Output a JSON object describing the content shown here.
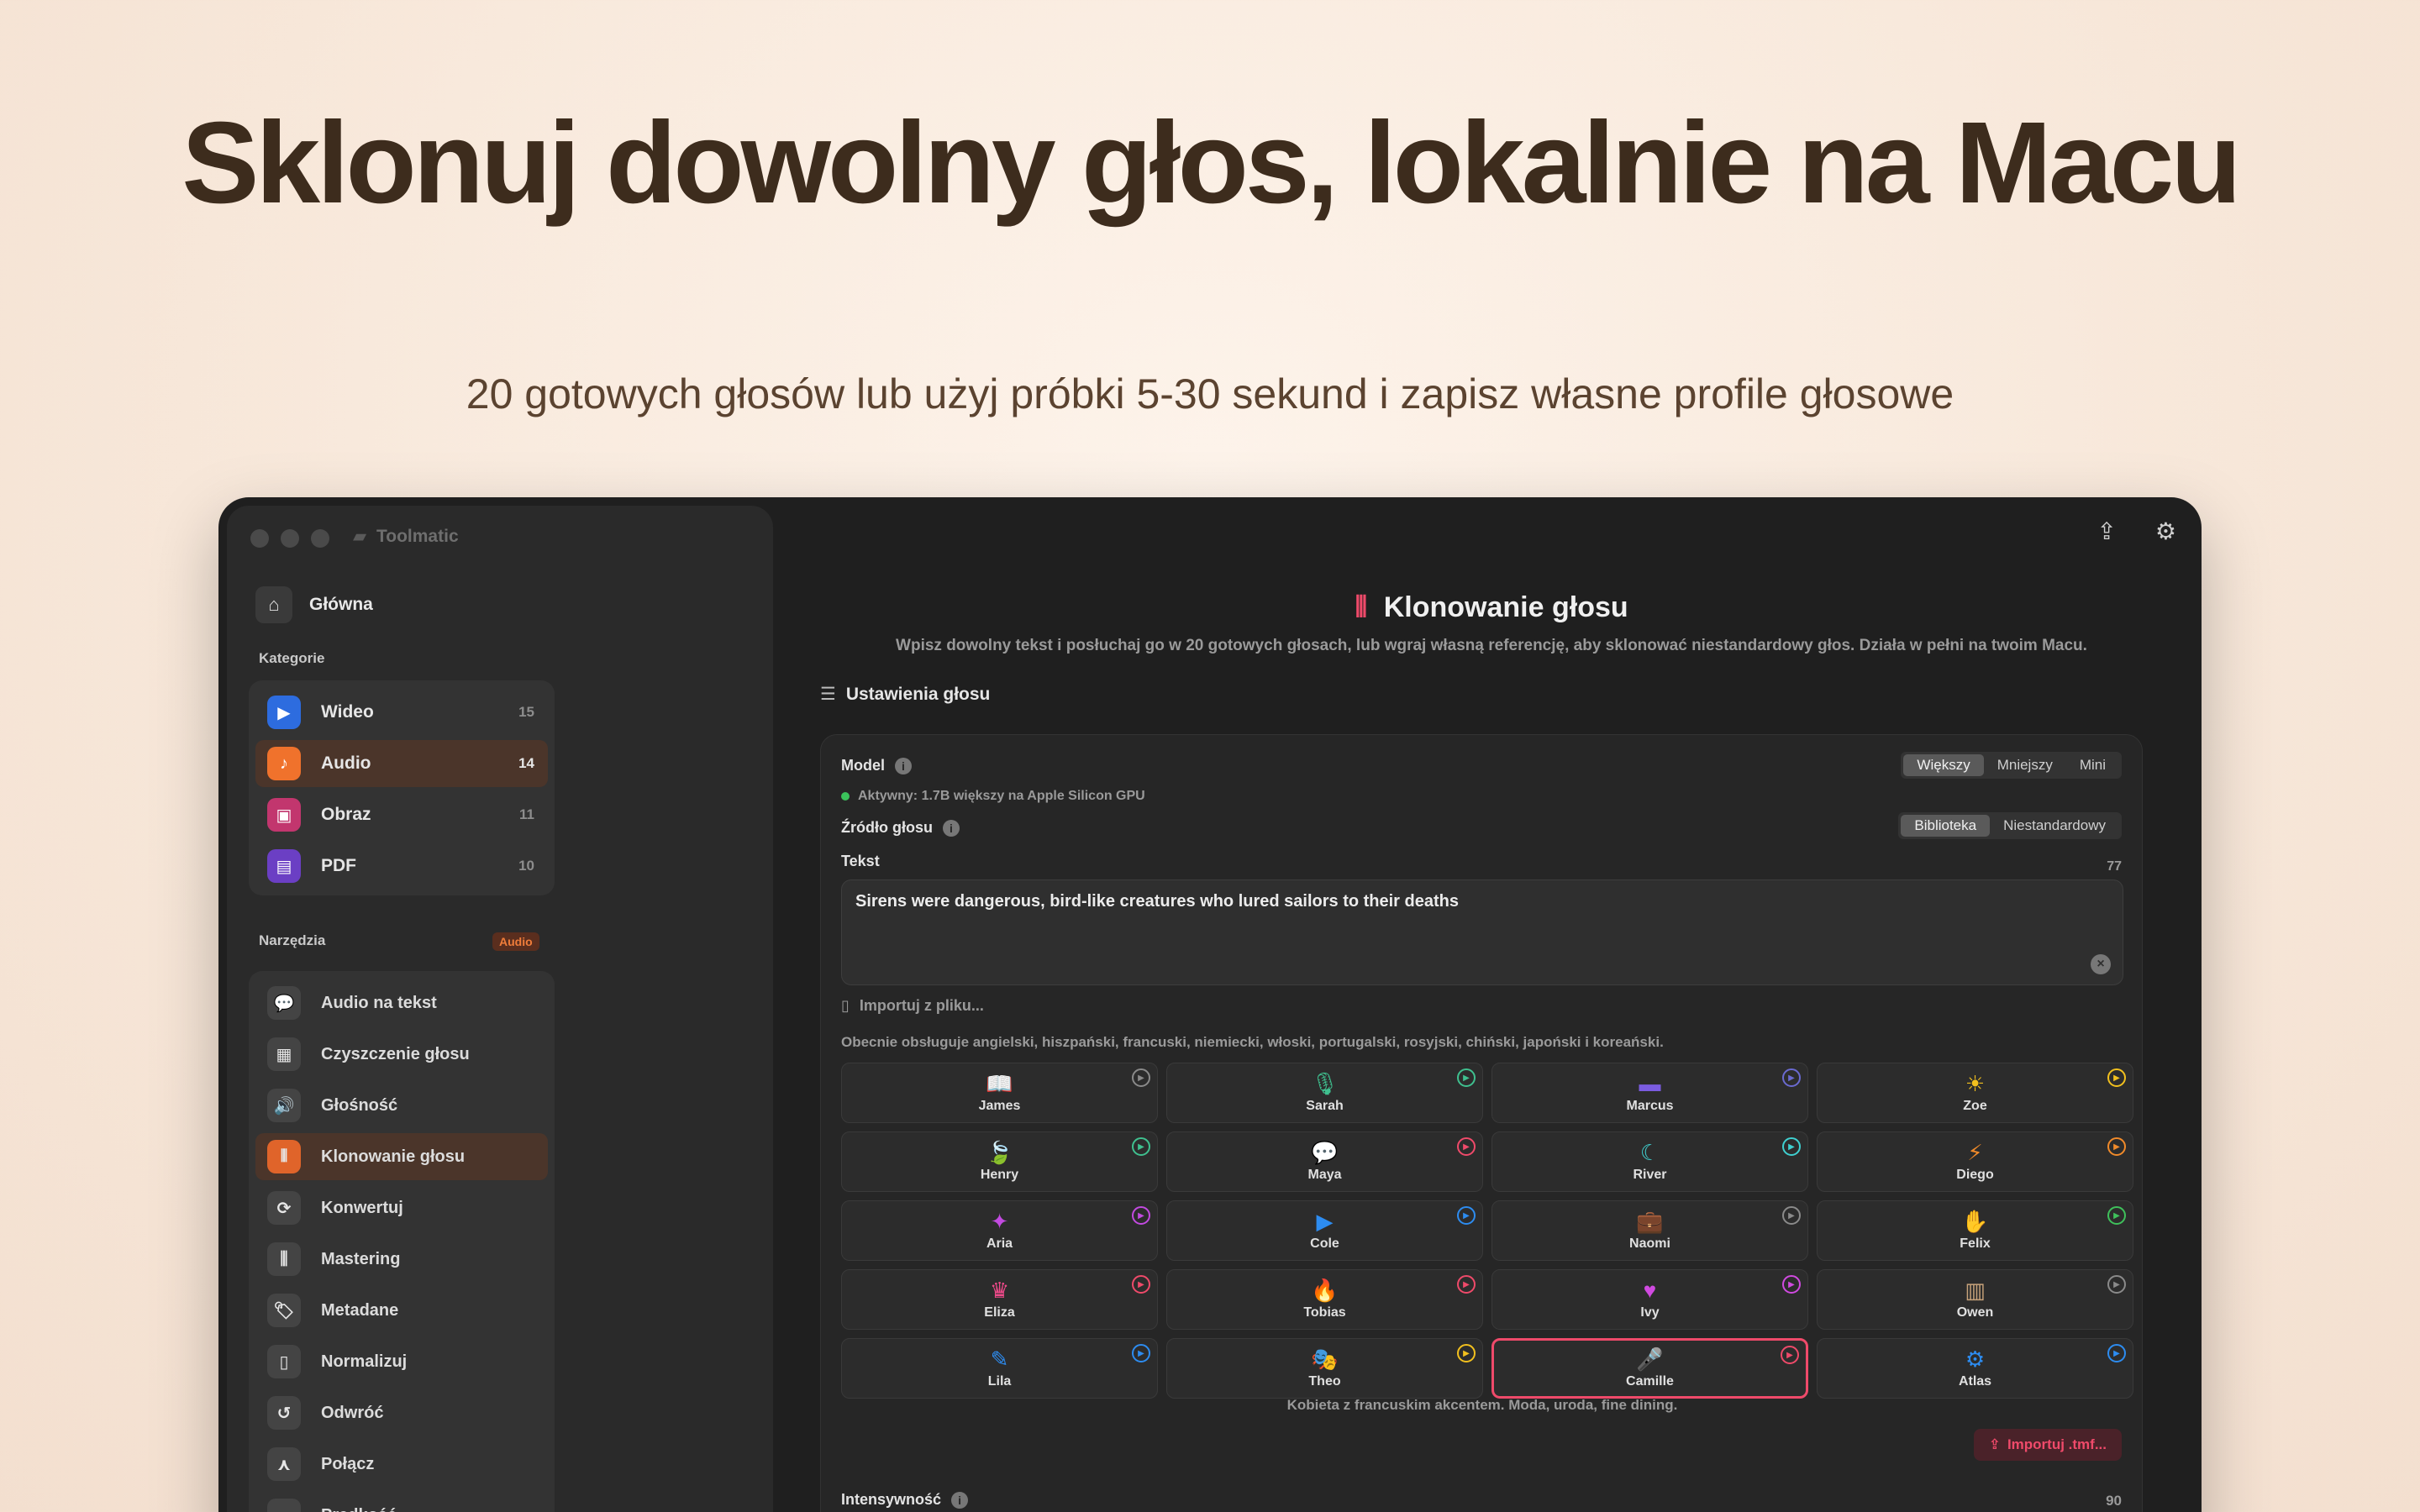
{
  "hero": {
    "title": "Sklonuj dowolny głos, lokalnie na Macu",
    "subtitle": "20 gotowych głosów lub użyj próbki 5-30 sekund i zapisz własne profile głosowe"
  },
  "window": {
    "app_name": "Toolmatic"
  },
  "sidebar": {
    "home_label": "Główna",
    "categories_label": "Kategorie",
    "categories": [
      {
        "label": "Wideo",
        "count": "15",
        "color": "#2d6cdf",
        "icon": "▶"
      },
      {
        "label": "Audio",
        "count": "14",
        "color": "#f0722c",
        "icon": "♪"
      },
      {
        "label": "Obraz",
        "count": "11",
        "color": "#c2366e",
        "icon": "▣"
      },
      {
        "label": "PDF",
        "count": "10",
        "color": "#6b3fc4",
        "icon": "▤"
      }
    ],
    "tools_label": "Narzędzia",
    "tools_badge": "Audio",
    "tools": [
      {
        "label": "Audio na tekst",
        "icon": "💬"
      },
      {
        "label": "Czyszczenie głosu",
        "icon": "▦"
      },
      {
        "label": "Głośność",
        "icon": "🔊"
      },
      {
        "label": "Klonowanie głosu",
        "icon": "⦀"
      },
      {
        "label": "Konwertuj",
        "icon": "⟳"
      },
      {
        "label": "Mastering",
        "icon": "⫼"
      },
      {
        "label": "Metadane",
        "icon": "🏷"
      },
      {
        "label": "Normalizuj",
        "icon": "▯"
      },
      {
        "label": "Odwróć",
        "icon": "↺"
      },
      {
        "label": "Połącz",
        "icon": "⋏"
      },
      {
        "label": "Prędkość",
        "icon": "◔"
      }
    ]
  },
  "main": {
    "title": "Klonowanie głosu",
    "description": "Wpisz dowolny tekst i posłuchaj go w 20 gotowych głosach, lub wgraj własną referencję, aby sklonować niestandardowy głos. Działa w pełni na twoim Macu.",
    "settings_label": "Ustawienia głosu",
    "model_label": "Model",
    "model_options": [
      "Większy",
      "Mniejszy",
      "Mini"
    ],
    "model_selected": "Większy",
    "active_text": "Aktywny: 1.7B większy na Apple Silicon GPU",
    "source_label": "Źródło głosu",
    "source_options": [
      "Biblioteka",
      "Niestandardowy"
    ],
    "source_selected": "Biblioteka",
    "text_label": "Tekst",
    "text_count": "77",
    "text_value": "Sirens were dangerous, bird-like creatures who lured sailors to their deaths",
    "import_label": "Importuj z pliku...",
    "support_text": "Obecnie obsługuje angielski, hiszpański, francuski, niemiecki, włoski, portugalski, rosyjski, chiński, japoński i koreański.",
    "voices": [
      {
        "name": "James",
        "icon": "📖",
        "color": "#c7a27a",
        "play": "#8a8a8a"
      },
      {
        "name": "Sarah",
        "icon": "🎙",
        "color": "#3fc08f",
        "play": "#3fc08f"
      },
      {
        "name": "Marcus",
        "icon": "▬",
        "color": "#7b5ce0",
        "play": "#6a6ad0"
      },
      {
        "name": "Zoe",
        "icon": "☀",
        "color": "#f2c01e",
        "play": "#f2c01e"
      },
      {
        "name": "Henry",
        "icon": "🍃",
        "color": "#3fc08f",
        "play": "#3fc08f"
      },
      {
        "name": "Maya",
        "icon": "💬",
        "color": "#ef4a6a",
        "play": "#ef4a6a"
      },
      {
        "name": "River",
        "icon": "☾",
        "color": "#3fd0d0",
        "play": "#3fd0d0"
      },
      {
        "name": "Diego",
        "icon": "⚡",
        "color": "#f08a2a",
        "play": "#f08a2a"
      },
      {
        "name": "Aria",
        "icon": "✦",
        "color": "#c24ae0",
        "play": "#c24ae0"
      },
      {
        "name": "Cole",
        "icon": "▶",
        "color": "#2d8cf0",
        "play": "#2d8cf0"
      },
      {
        "name": "Naomi",
        "icon": "💼",
        "color": "#c7a27a",
        "play": "#8a8a8a"
      },
      {
        "name": "Felix",
        "icon": "✋",
        "color": "#3fc05b",
        "play": "#3fc05b"
      },
      {
        "name": "Eliza",
        "icon": "♛",
        "color": "#ef4a8a",
        "play": "#ef4a6a"
      },
      {
        "name": "Tobias",
        "icon": "🔥",
        "color": "#ef4a4a",
        "play": "#ef4a6a"
      },
      {
        "name": "Ivy",
        "icon": "♥",
        "color": "#d04ae0",
        "play": "#d04ae0"
      },
      {
        "name": "Owen",
        "icon": "▥",
        "color": "#c7a27a",
        "play": "#8a8a8a"
      },
      {
        "name": "Lila",
        "icon": "✎",
        "color": "#2d8cf0",
        "play": "#2d8cf0"
      },
      {
        "name": "Theo",
        "icon": "🎭",
        "color": "#f2c01e",
        "play": "#f2c01e"
      },
      {
        "name": "Camille",
        "icon": "🎤",
        "color": "#ef4a6a",
        "play": "#ef4a6a"
      },
      {
        "name": "Atlas",
        "icon": "⚙",
        "color": "#2d8cf0",
        "play": "#2d8cf0"
      }
    ],
    "selected_voice": "Camille",
    "voice_description": "Kobieta z francuskim akcentem. Moda, uroda, fine dining.",
    "import_tmf": "Importuj .tmf...",
    "intensity_label": "Intensywność",
    "intensity_value": "90"
  },
  "colors": {
    "accent": "#ef4a6a",
    "audio_orange": "#f0722c"
  }
}
